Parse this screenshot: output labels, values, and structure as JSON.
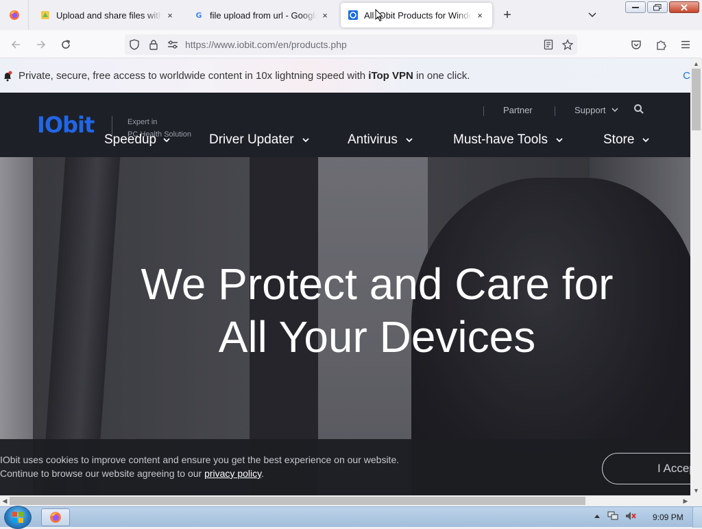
{
  "browser": {
    "tabs": [
      {
        "title": "Upload and share files with Zippy",
        "favicon": "zipp-favicon",
        "close": "×"
      },
      {
        "title": "file upload from url - Google Search",
        "favicon": "google-favicon",
        "close": "×"
      },
      {
        "title": "All IObit Products for Windows",
        "favicon": "iobit-favicon",
        "close": "×",
        "active": true
      }
    ],
    "new_tab": "+",
    "tab_list": "⌄",
    "window_buttons": {
      "minimize": "—",
      "restore": "❐",
      "close": "✕"
    },
    "url": "https://www.iobit.com/en/products.php"
  },
  "page": {
    "promo": {
      "text_before": "Private, secure, free access to worldwide content in 10x lightning speed with ",
      "brand": "iTop VPN",
      "text_after": "  in one click.",
      "cut_link": "C"
    },
    "header": {
      "logo": "IObit",
      "tagline_line1": "Expert in",
      "tagline_line2": "PC Health Solution",
      "top_links": {
        "partner": "Partner",
        "support": "Support"
      },
      "main_nav": [
        "Speedup",
        "Driver Updater",
        "Antivirus",
        "Must-have Tools",
        "Store"
      ]
    },
    "hero": {
      "line1": "We Protect and Care for",
      "line2": "All Your Devices"
    },
    "cookie": {
      "line1": "IObit uses cookies to improve content and ensure you get the best experience on our website.",
      "line2_before": "Continue to browse our website agreeing to our ",
      "policy_link": "privacy policy",
      "line2_after": ".",
      "accept": "I Accept"
    }
  },
  "taskbar": {
    "clock": "9:09 PM"
  },
  "colors": {
    "brand_blue": "#2166e5",
    "header_bg": "#1e2028",
    "promo_bg": "#eef0f8"
  }
}
